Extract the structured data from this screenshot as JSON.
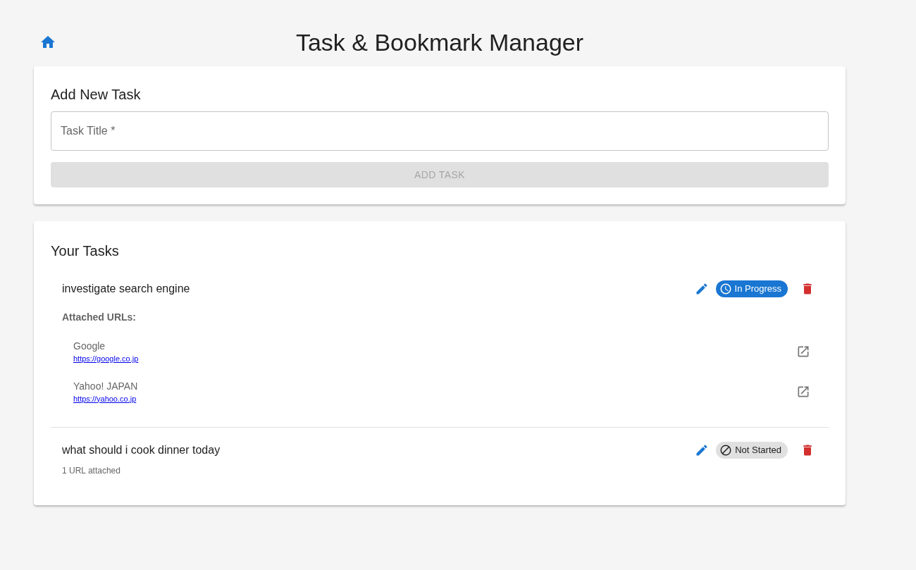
{
  "header": {
    "title": "Task & Bookmark Manager"
  },
  "add_task": {
    "heading": "Add New Task",
    "field": {
      "placeholder": "Task Title *"
    },
    "button": {
      "label": "ADD TASK",
      "disabled": true
    }
  },
  "tasks_panel": {
    "heading": "Your Tasks",
    "tasks": [
      {
        "title": "investigate search engine",
        "status": {
          "kind": "in_progress",
          "label": "In Progress"
        },
        "urls_heading": "Attached URLs:",
        "urls": [
          {
            "name": "Google",
            "url": "https://google.co.jp"
          },
          {
            "name": "Yahoo! JAPAN",
            "url": "https://yahoo.co.jp"
          }
        ]
      },
      {
        "title": "what should i cook dinner today",
        "status": {
          "kind": "not_started",
          "label": "Not Started"
        },
        "summary": "1 URL attached"
      }
    ]
  }
}
